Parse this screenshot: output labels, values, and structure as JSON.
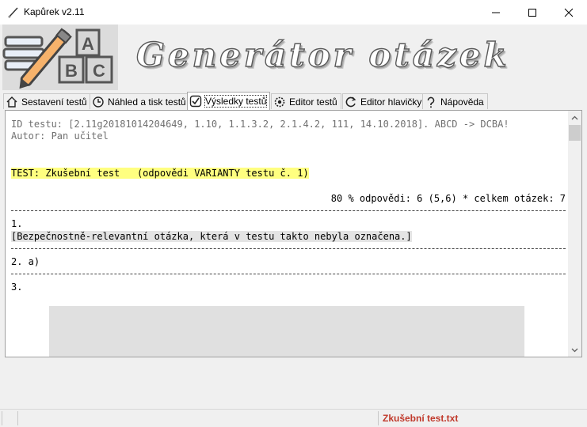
{
  "window": {
    "title": "Kapůrek v2.11"
  },
  "banner": {
    "title": "Generátor otázek",
    "logo_letters": [
      "A",
      "B",
      "C"
    ]
  },
  "tabs": [
    {
      "label": "Sestavení testů",
      "icon": "house-icon"
    },
    {
      "label": "Náhled a tisk testů",
      "icon": "clock-icon"
    },
    {
      "label": "Výsledky testů",
      "icon": "check-icon",
      "active": true
    },
    {
      "label": "Editor testů",
      "icon": "gear-icon"
    },
    {
      "label": "Editor hlavičky",
      "icon": "refresh-icon"
    },
    {
      "label": "Nápověda",
      "icon": "question-icon"
    }
  ],
  "results": {
    "id_line": "ID testu: [2.11g20181014204649, 1.10, 1.1.3.2, 2.1.4.2, 111, 14.10.2018]. ABCD -> DCBA!",
    "author_line": "Autor: Pan učitel",
    "test_line": "TEST: Zkušební test   (odpovědi VARIANTY testu č. 1)",
    "summary_line": "80 % odpovědi: 6 (5,6) * celkem otázek: 7",
    "q1_number": "1.",
    "q1_text": "[Bezpečnostně-relevantní otázka, která v testu takto nebyla označena.]",
    "q2_line": "2. a)",
    "q3_number": "3."
  },
  "status": {
    "panel1": "",
    "panel2": "",
    "filename": "Zkušební test.txt"
  },
  "colors": {
    "highlight_yellow": "#ffff80",
    "status_file": "#c0392b"
  }
}
